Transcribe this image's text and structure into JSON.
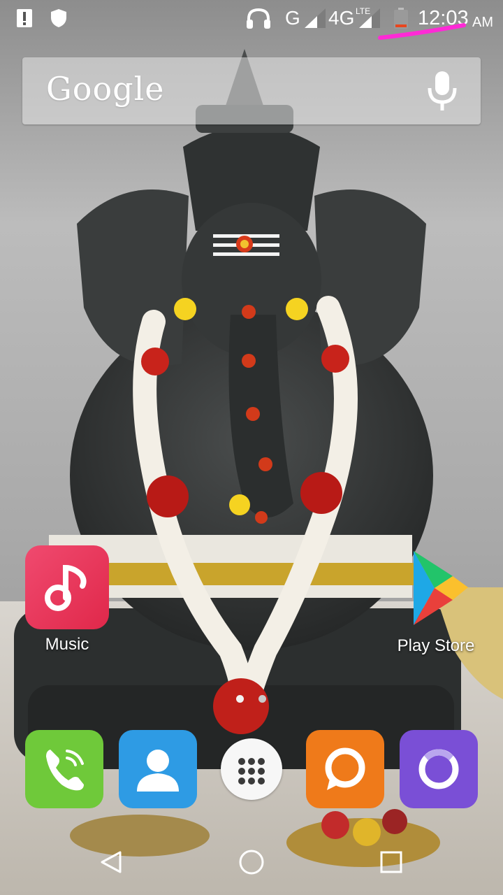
{
  "status_bar": {
    "network_type": "G",
    "data_type": "4G",
    "lte_label": "LTE",
    "time": "12:03",
    "ampm": "AM"
  },
  "search": {
    "logo_text": "Google"
  },
  "apps": {
    "music_label": "Music",
    "play_store_label": "Play Store"
  },
  "page_indicator": {
    "pages": 2,
    "current": 1
  },
  "dock": [
    "phone-icon",
    "contacts-icon",
    "app-drawer-icon",
    "messaging-icon",
    "browser-icon"
  ],
  "colors": {
    "music_tile": "#e8335a",
    "phone_tile": "#6fc93a",
    "contacts_tile": "#2e9be4",
    "messaging_tile": "#ef7a1a",
    "browser_tile": "#7a4fd6",
    "annotation": "#ff2ad6"
  }
}
